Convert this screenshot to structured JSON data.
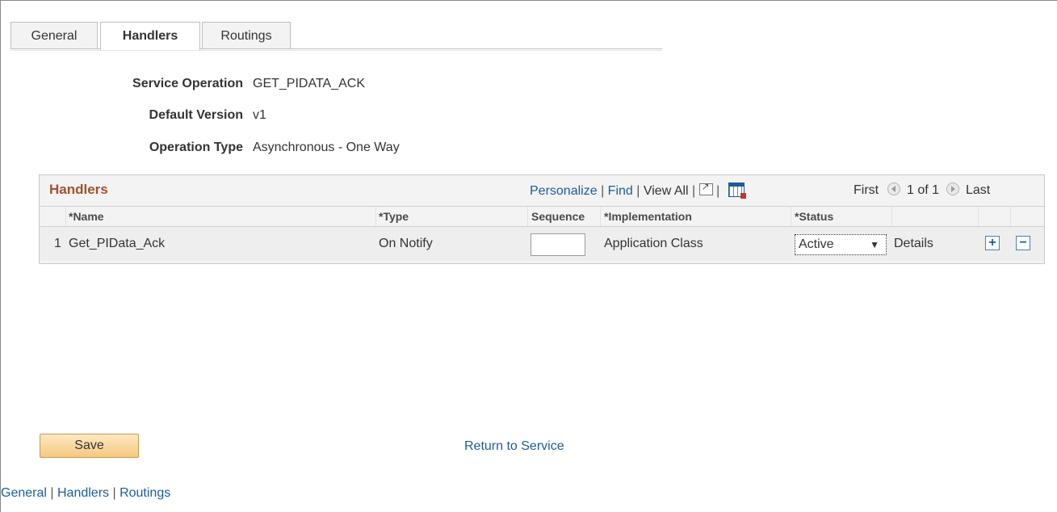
{
  "tabs": [
    {
      "label": "General",
      "active": false
    },
    {
      "label": "Handlers",
      "active": true
    },
    {
      "label": "Routings",
      "active": false
    }
  ],
  "info": {
    "service_operation": {
      "label": "Service Operation",
      "value": "GET_PIDATA_ACK"
    },
    "default_version": {
      "label": "Default Version",
      "value": "v1"
    },
    "operation_type": {
      "label": "Operation Type",
      "value": "Asynchronous - One Way"
    }
  },
  "grid": {
    "title": "Handlers",
    "personalize": "Personalize",
    "find": "Find",
    "view_all": "View All",
    "sep": "|",
    "first": "First",
    "page_info": "1 of 1",
    "last": "Last",
    "columns": {
      "name": "*Name",
      "type": "*Type",
      "sequence": "Sequence",
      "implementation": "*Implementation",
      "status": "*Status"
    },
    "rows": [
      {
        "num": "1",
        "name": "Get_PIData_Ack",
        "type": "On Notify",
        "sequence": "",
        "implementation": "Application Class",
        "status": "Active",
        "details": "Details",
        "add": "+",
        "remove": "−"
      }
    ]
  },
  "footer": {
    "save": "Save",
    "return": "Return to Service",
    "links": [
      "General",
      "Handlers",
      "Routings"
    ],
    "sep": "|"
  },
  "colors": {
    "link": "#1c5c9b",
    "grid_title": "#a0522d",
    "save_bg": "#f5c880"
  }
}
